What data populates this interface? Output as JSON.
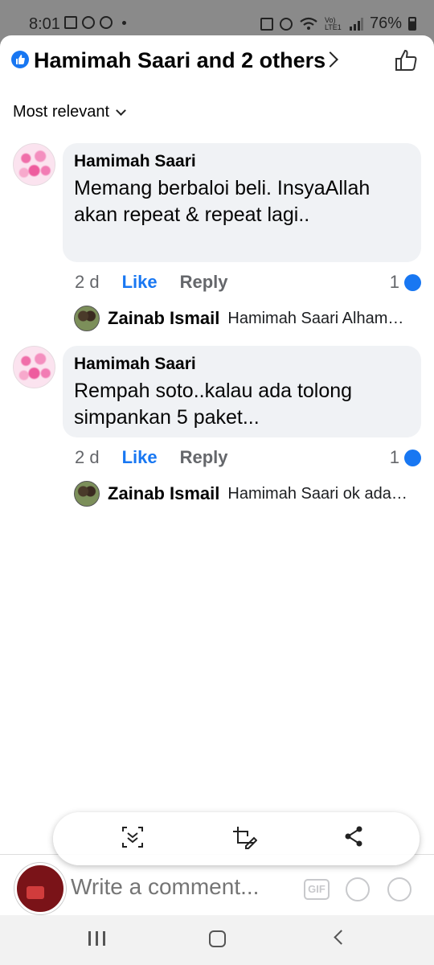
{
  "status_bar": {
    "time": "8:01",
    "battery": "76%",
    "network_label": "Vo) LTE1"
  },
  "header": {
    "title": "Hamimah Saari and 2 others",
    "reaction_icon": "like-reaction-icon",
    "action_icon": "thumbs-up-outline-icon"
  },
  "filter": {
    "label": "Most relevant"
  },
  "comments": [
    {
      "author": "Hamimah Saari",
      "text": "Memang berbaloi beli. InsyaAllah akan repeat & repeat lagi..",
      "age": "2 d",
      "like_label": "Like",
      "reply_label": "Reply",
      "reaction_count": "1",
      "reply": {
        "author": "Zainab Ismail",
        "text": "Hamimah Saari Alham…"
      }
    },
    {
      "author": "Hamimah Saari",
      "text": "Rempah soto..kalau ada tolong simpankan 5 paket...",
      "age": "2 d",
      "like_label": "Like",
      "reply_label": "Reply",
      "reaction_count": "1",
      "reply": {
        "author": "Zainab Ismail",
        "text": "Hamimah Saari ok ada…"
      }
    }
  ],
  "composer": {
    "placeholder": "Write a comment...",
    "gif_label": "GIF"
  },
  "colors": {
    "accent": "#1877f2",
    "bubble": "#f0f2f5",
    "secondary_text": "#65676b"
  }
}
